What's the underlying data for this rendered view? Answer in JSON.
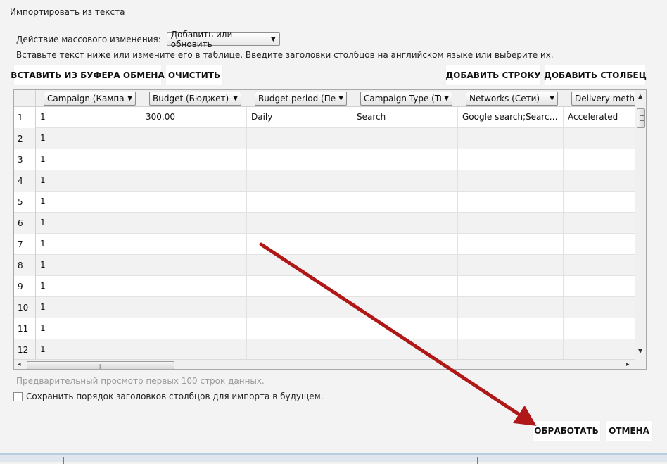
{
  "dialog": {
    "title": "Импортировать из текста"
  },
  "bulk": {
    "label": "Действие массового изменения:",
    "selected": "Добавить или обновить"
  },
  "hint": "Вставьте текст ниже или измените его в таблице. Введите заголовки столбцов на английском языке или выберите их.",
  "toolbar": {
    "paste": "ВСТАВИТЬ ИЗ БУФЕРА ОБМЕНА",
    "clear": "ОЧИСТИТЬ",
    "add_row": "ДОБАВИТЬ СТРОКУ",
    "add_column": "ДОБАВИТЬ СТОЛБЕЦ"
  },
  "grid": {
    "columns": [
      "Campaign (Кампани",
      "Budget (Бюджет)",
      "Budget period (Пер",
      "Campaign Type (Ти",
      "Networks (Сети)",
      "Delivery method"
    ],
    "rows": [
      {
        "num": "1",
        "cells": [
          "1",
          "300.00",
          "Daily",
          "Search",
          "Google search;Search ...",
          "Accelerated"
        ]
      },
      {
        "num": "2",
        "cells": [
          "1",
          "",
          "",
          "",
          "",
          ""
        ]
      },
      {
        "num": "3",
        "cells": [
          "1",
          "",
          "",
          "",
          "",
          ""
        ]
      },
      {
        "num": "4",
        "cells": [
          "1",
          "",
          "",
          "",
          "",
          ""
        ]
      },
      {
        "num": "5",
        "cells": [
          "1",
          "",
          "",
          "",
          "",
          ""
        ]
      },
      {
        "num": "6",
        "cells": [
          "1",
          "",
          "",
          "",
          "",
          ""
        ]
      },
      {
        "num": "7",
        "cells": [
          "1",
          "",
          "",
          "",
          "",
          ""
        ]
      },
      {
        "num": "8",
        "cells": [
          "1",
          "",
          "",
          "",
          "",
          ""
        ]
      },
      {
        "num": "9",
        "cells": [
          "1",
          "",
          "",
          "",
          "",
          ""
        ]
      },
      {
        "num": "10",
        "cells": [
          "1",
          "",
          "",
          "",
          "",
          ""
        ]
      },
      {
        "num": "11",
        "cells": [
          "1",
          "",
          "",
          "",
          "",
          ""
        ]
      },
      {
        "num": "12",
        "cells": [
          "1",
          "",
          "",
          "",
          "",
          ""
        ]
      }
    ]
  },
  "preview_note": "Предварительный просмотр первых 100 строк данных.",
  "save_order": {
    "label": "Сохранить порядок заголовков столбцов для импорта в будущем.",
    "checked": false
  },
  "footer": {
    "process": "ОБРАБОТАТЬ",
    "cancel": "ОТМЕНА"
  },
  "colors": {
    "annotation_arrow": "#b01818",
    "row_alt": "#f2f2f2",
    "background": "#f3f3f3"
  },
  "icons": {
    "dropdown": "caret-down-icon",
    "checkbox": "checkbox-icon",
    "annotation": "red-arrow-annotation"
  }
}
